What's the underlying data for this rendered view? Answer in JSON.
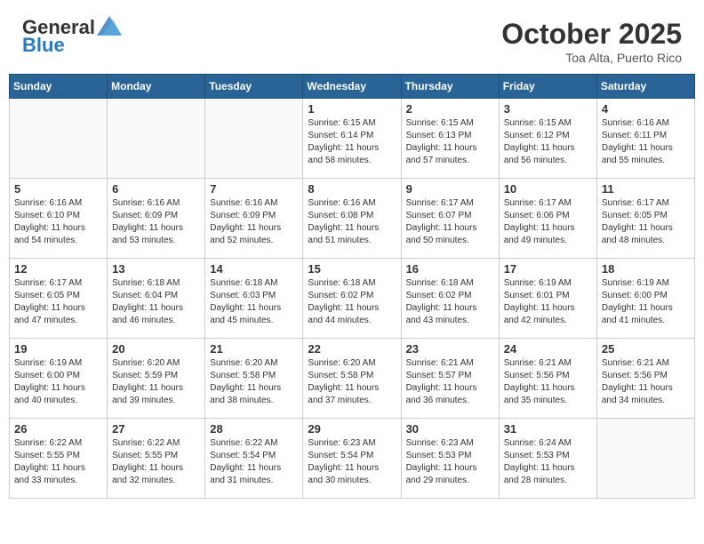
{
  "header": {
    "logo_general": "General",
    "logo_blue": "Blue",
    "month": "October 2025",
    "location": "Toa Alta, Puerto Rico"
  },
  "days_of_week": [
    "Sunday",
    "Monday",
    "Tuesday",
    "Wednesday",
    "Thursday",
    "Friday",
    "Saturday"
  ],
  "weeks": [
    [
      {
        "day": "",
        "info": ""
      },
      {
        "day": "",
        "info": ""
      },
      {
        "day": "",
        "info": ""
      },
      {
        "day": "1",
        "info": "Sunrise: 6:15 AM\nSunset: 6:14 PM\nDaylight: 11 hours\nand 58 minutes."
      },
      {
        "day": "2",
        "info": "Sunrise: 6:15 AM\nSunset: 6:13 PM\nDaylight: 11 hours\nand 57 minutes."
      },
      {
        "day": "3",
        "info": "Sunrise: 6:15 AM\nSunset: 6:12 PM\nDaylight: 11 hours\nand 56 minutes."
      },
      {
        "day": "4",
        "info": "Sunrise: 6:16 AM\nSunset: 6:11 PM\nDaylight: 11 hours\nand 55 minutes."
      }
    ],
    [
      {
        "day": "5",
        "info": "Sunrise: 6:16 AM\nSunset: 6:10 PM\nDaylight: 11 hours\nand 54 minutes."
      },
      {
        "day": "6",
        "info": "Sunrise: 6:16 AM\nSunset: 6:09 PM\nDaylight: 11 hours\nand 53 minutes."
      },
      {
        "day": "7",
        "info": "Sunrise: 6:16 AM\nSunset: 6:09 PM\nDaylight: 11 hours\nand 52 minutes."
      },
      {
        "day": "8",
        "info": "Sunrise: 6:16 AM\nSunset: 6:08 PM\nDaylight: 11 hours\nand 51 minutes."
      },
      {
        "day": "9",
        "info": "Sunrise: 6:17 AM\nSunset: 6:07 PM\nDaylight: 11 hours\nand 50 minutes."
      },
      {
        "day": "10",
        "info": "Sunrise: 6:17 AM\nSunset: 6:06 PM\nDaylight: 11 hours\nand 49 minutes."
      },
      {
        "day": "11",
        "info": "Sunrise: 6:17 AM\nSunset: 6:05 PM\nDaylight: 11 hours\nand 48 minutes."
      }
    ],
    [
      {
        "day": "12",
        "info": "Sunrise: 6:17 AM\nSunset: 6:05 PM\nDaylight: 11 hours\nand 47 minutes."
      },
      {
        "day": "13",
        "info": "Sunrise: 6:18 AM\nSunset: 6:04 PM\nDaylight: 11 hours\nand 46 minutes."
      },
      {
        "day": "14",
        "info": "Sunrise: 6:18 AM\nSunset: 6:03 PM\nDaylight: 11 hours\nand 45 minutes."
      },
      {
        "day": "15",
        "info": "Sunrise: 6:18 AM\nSunset: 6:02 PM\nDaylight: 11 hours\nand 44 minutes."
      },
      {
        "day": "16",
        "info": "Sunrise: 6:18 AM\nSunset: 6:02 PM\nDaylight: 11 hours\nand 43 minutes."
      },
      {
        "day": "17",
        "info": "Sunrise: 6:19 AM\nSunset: 6:01 PM\nDaylight: 11 hours\nand 42 minutes."
      },
      {
        "day": "18",
        "info": "Sunrise: 6:19 AM\nSunset: 6:00 PM\nDaylight: 11 hours\nand 41 minutes."
      }
    ],
    [
      {
        "day": "19",
        "info": "Sunrise: 6:19 AM\nSunset: 6:00 PM\nDaylight: 11 hours\nand 40 minutes."
      },
      {
        "day": "20",
        "info": "Sunrise: 6:20 AM\nSunset: 5:59 PM\nDaylight: 11 hours\nand 39 minutes."
      },
      {
        "day": "21",
        "info": "Sunrise: 6:20 AM\nSunset: 5:58 PM\nDaylight: 11 hours\nand 38 minutes."
      },
      {
        "day": "22",
        "info": "Sunrise: 6:20 AM\nSunset: 5:58 PM\nDaylight: 11 hours\nand 37 minutes."
      },
      {
        "day": "23",
        "info": "Sunrise: 6:21 AM\nSunset: 5:57 PM\nDaylight: 11 hours\nand 36 minutes."
      },
      {
        "day": "24",
        "info": "Sunrise: 6:21 AM\nSunset: 5:56 PM\nDaylight: 11 hours\nand 35 minutes."
      },
      {
        "day": "25",
        "info": "Sunrise: 6:21 AM\nSunset: 5:56 PM\nDaylight: 11 hours\nand 34 minutes."
      }
    ],
    [
      {
        "day": "26",
        "info": "Sunrise: 6:22 AM\nSunset: 5:55 PM\nDaylight: 11 hours\nand 33 minutes."
      },
      {
        "day": "27",
        "info": "Sunrise: 6:22 AM\nSunset: 5:55 PM\nDaylight: 11 hours\nand 32 minutes."
      },
      {
        "day": "28",
        "info": "Sunrise: 6:22 AM\nSunset: 5:54 PM\nDaylight: 11 hours\nand 31 minutes."
      },
      {
        "day": "29",
        "info": "Sunrise: 6:23 AM\nSunset: 5:54 PM\nDaylight: 11 hours\nand 30 minutes."
      },
      {
        "day": "30",
        "info": "Sunrise: 6:23 AM\nSunset: 5:53 PM\nDaylight: 11 hours\nand 29 minutes."
      },
      {
        "day": "31",
        "info": "Sunrise: 6:24 AM\nSunset: 5:53 PM\nDaylight: 11 hours\nand 28 minutes."
      },
      {
        "day": "",
        "info": ""
      }
    ]
  ]
}
